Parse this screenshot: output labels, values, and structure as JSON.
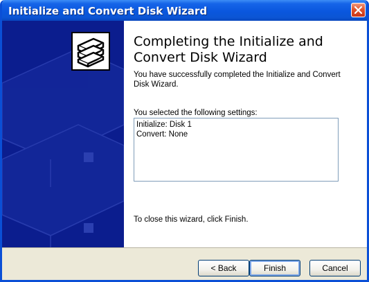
{
  "window": {
    "title": "Initialize and Convert Disk Wizard"
  },
  "content": {
    "heading": "Completing the Initialize and Convert Disk Wizard",
    "description": "You have successfully completed the Initialize and Convert Disk Wizard.",
    "settings_label": "You selected the following settings:",
    "settings": [
      "Initialize: Disk 1",
      "Convert: None"
    ],
    "close_instruction": "To close this wizard, click Finish."
  },
  "buttons": {
    "back": "< Back",
    "finish": "Finish",
    "cancel": "Cancel"
  },
  "colors": {
    "title_bar": "#0a57de",
    "side_panel": "#0b1d8e",
    "close_button": "#e0542c"
  },
  "icons": {
    "wizard": "disk-stack-icon",
    "close": "close-icon"
  }
}
